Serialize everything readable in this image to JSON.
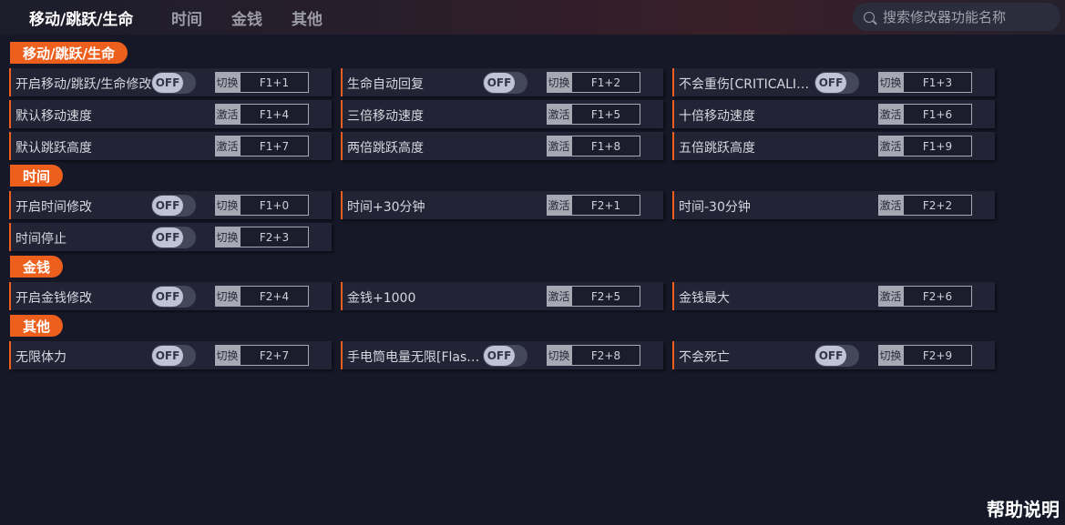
{
  "tabs": [
    "移动/跳跃/生命",
    "时间",
    "金钱",
    "其他"
  ],
  "search": {
    "placeholder": "搜索修改器功能名称"
  },
  "toggle_off": "OFF",
  "sections": [
    {
      "title": "移动/跳跃/生命",
      "rows": [
        [
          {
            "label": "开启移动/跳跃/生命修改",
            "toggle": true,
            "mode": "切换",
            "key": "F1+1"
          },
          {
            "label": "生命自动回复",
            "toggle": true,
            "mode": "切换",
            "key": "F1+2"
          },
          {
            "label": "不会重伤[CRITICALINJURY]",
            "toggle": true,
            "mode": "切换",
            "key": "F1+3"
          }
        ],
        [
          {
            "label": "默认移动速度",
            "toggle": false,
            "mode": "激活",
            "key": "F1+4"
          },
          {
            "label": "三倍移动速度",
            "toggle": false,
            "mode": "激活",
            "key": "F1+5"
          },
          {
            "label": "十倍移动速度",
            "toggle": false,
            "mode": "激活",
            "key": "F1+6"
          }
        ],
        [
          {
            "label": "默认跳跃高度",
            "toggle": false,
            "mode": "激活",
            "key": "F1+7"
          },
          {
            "label": "两倍跳跃高度",
            "toggle": false,
            "mode": "激活",
            "key": "F1+8"
          },
          {
            "label": "五倍跳跃高度",
            "toggle": false,
            "mode": "激活",
            "key": "F1+9"
          }
        ]
      ]
    },
    {
      "title": "时间",
      "rows": [
        [
          {
            "label": "开启时间修改",
            "toggle": true,
            "mode": "切换",
            "key": "F1+0"
          },
          {
            "label": "时间+30分钟",
            "toggle": false,
            "mode": "激活",
            "key": "F2+1"
          },
          {
            "label": "时间-30分钟",
            "toggle": false,
            "mode": "激活",
            "key": "F2+2"
          }
        ],
        [
          {
            "label": "时间停止",
            "toggle": true,
            "mode": "切换",
            "key": "F2+3"
          }
        ]
      ]
    },
    {
      "title": "金钱",
      "rows": [
        [
          {
            "label": "开启金钱修改",
            "toggle": true,
            "mode": "切换",
            "key": "F2+4"
          },
          {
            "label": "金钱+1000",
            "toggle": false,
            "mode": "激活",
            "key": "F2+5"
          },
          {
            "label": "金钱最大",
            "toggle": false,
            "mode": "激活",
            "key": "F2+6"
          }
        ]
      ]
    },
    {
      "title": "其他",
      "rows": [
        [
          {
            "label": "无限体力",
            "toggle": true,
            "mode": "切换",
            "key": "F2+7"
          },
          {
            "label": "手电筒电量无限[Flashlight]",
            "toggle": true,
            "mode": "切换",
            "key": "F2+8"
          },
          {
            "label": "不会死亡",
            "toggle": true,
            "mode": "切换",
            "key": "F2+9"
          }
        ]
      ]
    }
  ],
  "help": "帮助说明",
  "colors": {
    "accent": "#ec5f1d",
    "background": "#161827",
    "row": "#222436"
  }
}
